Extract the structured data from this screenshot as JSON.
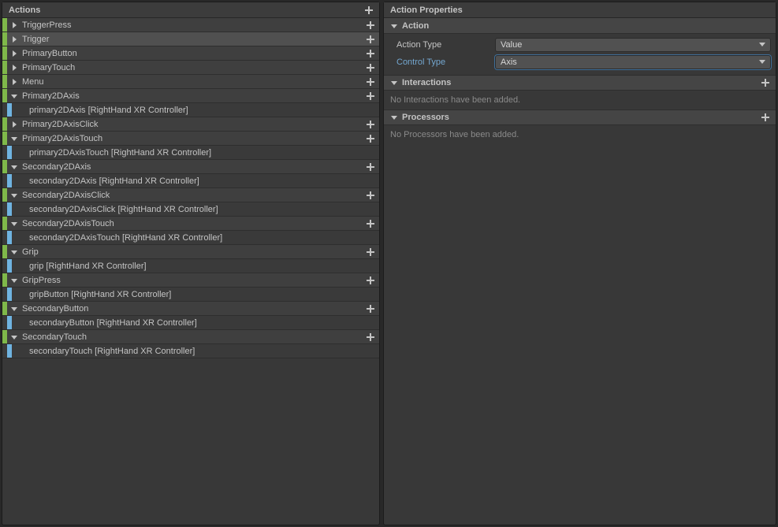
{
  "actionsPanel": {
    "title": "Actions",
    "items": [
      {
        "label": "TriggerPress",
        "expanded": false,
        "selected": false,
        "bindings": []
      },
      {
        "label": "Trigger",
        "expanded": false,
        "selected": true,
        "bindings": []
      },
      {
        "label": "PrimaryButton",
        "expanded": false,
        "selected": false,
        "bindings": []
      },
      {
        "label": "PrimaryTouch",
        "expanded": false,
        "selected": false,
        "bindings": []
      },
      {
        "label": "Menu",
        "expanded": false,
        "selected": false,
        "bindings": []
      },
      {
        "label": "Primary2DAxis",
        "expanded": true,
        "selected": false,
        "bindings": [
          {
            "label": "primary2DAxis [RightHand XR Controller]"
          }
        ]
      },
      {
        "label": "Primary2DAxisClick",
        "expanded": false,
        "selected": false,
        "bindings": []
      },
      {
        "label": "Primary2DAxisTouch",
        "expanded": true,
        "selected": false,
        "bindings": [
          {
            "label": "primary2DAxisTouch [RightHand XR Controller]"
          }
        ]
      },
      {
        "label": "Secondary2DAxis",
        "expanded": true,
        "selected": false,
        "bindings": [
          {
            "label": "secondary2DAxis [RightHand XR Controller]"
          }
        ]
      },
      {
        "label": "Secondary2DAxisClick",
        "expanded": true,
        "selected": false,
        "bindings": [
          {
            "label": "secondary2DAxisClick [RightHand XR Controller]"
          }
        ]
      },
      {
        "label": "Secondary2DAxisTouch",
        "expanded": true,
        "selected": false,
        "bindings": [
          {
            "label": "secondary2DAxisTouch [RightHand XR Controller]"
          }
        ]
      },
      {
        "label": "Grip",
        "expanded": true,
        "selected": false,
        "bindings": [
          {
            "label": "grip [RightHand XR Controller]"
          }
        ]
      },
      {
        "label": "GripPress",
        "expanded": true,
        "selected": false,
        "bindings": [
          {
            "label": "gripButton [RightHand XR Controller]"
          }
        ]
      },
      {
        "label": "SecondaryButton",
        "expanded": true,
        "selected": false,
        "bindings": [
          {
            "label": "secondaryButton [RightHand XR Controller]"
          }
        ]
      },
      {
        "label": "SecondaryTouch",
        "expanded": true,
        "selected": false,
        "bindings": [
          {
            "label": "secondaryTouch [RightHand XR Controller]"
          }
        ]
      }
    ]
  },
  "propertiesPanel": {
    "title": "Action Properties",
    "sections": {
      "action": {
        "title": "Action",
        "fields": {
          "actionType": {
            "label": "Action Type",
            "value": "Value"
          },
          "controlType": {
            "label": "Control Type",
            "value": "Axis"
          }
        }
      },
      "interactions": {
        "title": "Interactions",
        "empty": "No Interactions have been added."
      },
      "processors": {
        "title": "Processors",
        "empty": "No Processors have been added."
      }
    }
  }
}
